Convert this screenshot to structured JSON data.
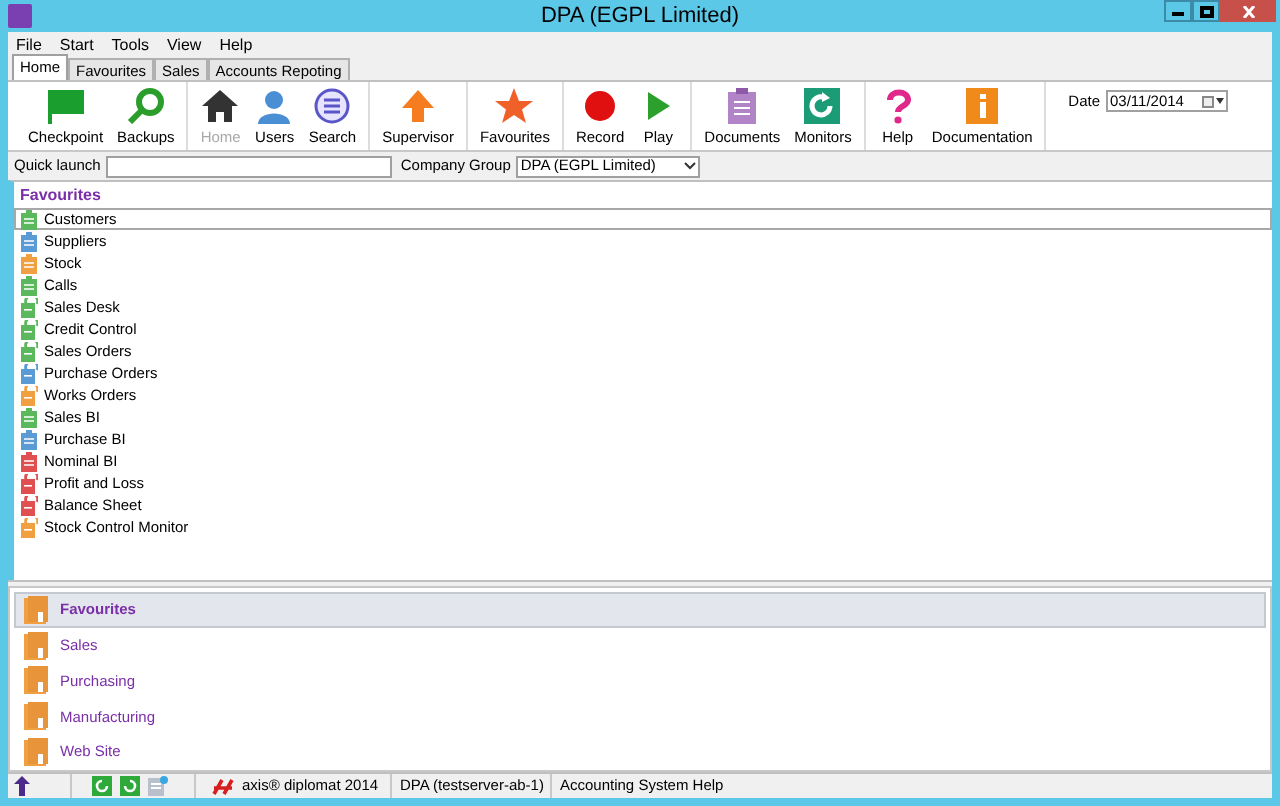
{
  "window": {
    "title": "DPA (EGPL Limited)"
  },
  "menu": [
    "File",
    "Start",
    "Tools",
    "View",
    "Help"
  ],
  "tabs": [
    {
      "label": "Home",
      "selected": true
    },
    {
      "label": "Favourites",
      "selected": false
    },
    {
      "label": "Sales",
      "selected": false
    },
    {
      "label": "Accounts Repoting",
      "selected": false
    }
  ],
  "toolbar": [
    [
      {
        "label": "Checkpoint",
        "disabled": false
      },
      {
        "label": "Backups",
        "disabled": false
      }
    ],
    [
      {
        "label": "Home",
        "disabled": true
      },
      {
        "label": "Users",
        "disabled": false
      },
      {
        "label": "Search",
        "disabled": false
      }
    ],
    [
      {
        "label": "Supervisor",
        "disabled": false
      }
    ],
    [
      {
        "label": "Favourites",
        "disabled": false
      }
    ],
    [
      {
        "label": "Record",
        "disabled": false
      },
      {
        "label": "Play",
        "disabled": false
      }
    ],
    [
      {
        "label": "Documents",
        "disabled": false
      },
      {
        "label": "Monitors",
        "disabled": false
      }
    ],
    [
      {
        "label": "Help",
        "disabled": false
      },
      {
        "label": "Documentation",
        "disabled": false
      }
    ]
  ],
  "date": {
    "label": "Date",
    "value": "03/11/2014"
  },
  "quick_launch": {
    "label": "Quick launch"
  },
  "company_group": {
    "label": "Company Group",
    "value": "DPA (EGPL Limited)"
  },
  "favourites": {
    "title": "Favourites",
    "items": [
      {
        "label": "Customers",
        "kind": "list",
        "color": "#5cb85c",
        "selected": true
      },
      {
        "label": "Suppliers",
        "kind": "list",
        "color": "#5b9bd5",
        "selected": false
      },
      {
        "label": "Stock",
        "kind": "list",
        "color": "#f0a040",
        "selected": false
      },
      {
        "label": "Calls",
        "kind": "list",
        "color": "#5cb85c",
        "selected": false
      },
      {
        "label": "Sales Desk",
        "kind": "monitor",
        "color": "#5cb85c",
        "selected": false
      },
      {
        "label": "Credit Control",
        "kind": "monitor",
        "color": "#5cb85c",
        "selected": false
      },
      {
        "label": "Sales Orders",
        "kind": "monitor",
        "color": "#5cb85c",
        "selected": false
      },
      {
        "label": "Purchase Orders",
        "kind": "monitor",
        "color": "#5b9bd5",
        "selected": false
      },
      {
        "label": "Works Orders",
        "kind": "monitor",
        "color": "#f0a040",
        "selected": false
      },
      {
        "label": "Sales BI",
        "kind": "list",
        "color": "#5cb85c",
        "selected": false
      },
      {
        "label": "Purchase BI",
        "kind": "list",
        "color": "#5b9bd5",
        "selected": false
      },
      {
        "label": "Nominal BI",
        "kind": "list",
        "color": "#e05050",
        "selected": false
      },
      {
        "label": "Profit and Loss",
        "kind": "monitor",
        "color": "#e05050",
        "selected": false
      },
      {
        "label": "Balance Sheet",
        "kind": "monitor",
        "color": "#e05050",
        "selected": false
      },
      {
        "label": "Stock Control Monitor",
        "kind": "monitor",
        "color": "#f0a040",
        "selected": false
      }
    ]
  },
  "navigation": [
    {
      "label": "Favourites",
      "selected": true
    },
    {
      "label": "Sales",
      "selected": false
    },
    {
      "label": "Purchasing",
      "selected": false
    },
    {
      "label": "Manufacturing",
      "selected": false
    },
    {
      "label": "Web Site",
      "selected": false
    }
  ],
  "status_bar": {
    "product": "axis® diplomat 2014",
    "server": "DPA (testserver-ab-1)",
    "help": "Accounting System Help"
  }
}
